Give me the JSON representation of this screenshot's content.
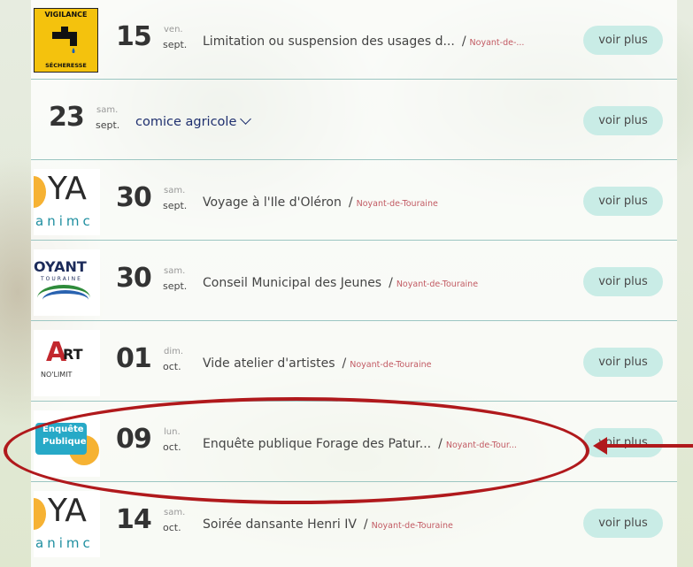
{
  "events": [
    {
      "day": "15",
      "dow": "ven.",
      "month": "sept.",
      "title": "Limitation ou suspension des usages d...",
      "location": "Noyant-de-...",
      "button": "voir plus",
      "thumb": "vigilance",
      "thumb_text": {
        "top": "VIGILANCE",
        "bottom": "SÉCHERESSE"
      }
    },
    {
      "day": "23",
      "dow": "sam.",
      "month": "sept.",
      "title": "comice agricole",
      "button": "voir plus"
    },
    {
      "day": "30",
      "dow": "sam.",
      "month": "sept.",
      "title": "Voyage à l'Ile d'Oléron",
      "location": "Noyant-de-Touraine",
      "button": "voir plus",
      "thumb": "ya",
      "thumb_text": {
        "main": "YA",
        "sub": "animc"
      }
    },
    {
      "day": "30",
      "dow": "sam.",
      "month": "sept.",
      "title": "Conseil Municipal des Jeunes",
      "location": "Noyant-de-Touraine",
      "button": "voir plus",
      "thumb": "noyant",
      "thumb_text": {
        "main": "OYANT",
        "sub": "TOURAINE"
      }
    },
    {
      "day": "01",
      "dow": "dim.",
      "month": "oct.",
      "title": "Vide atelier d'artistes",
      "location": "Noyant-de-Touraine",
      "button": "voir plus",
      "thumb": "art",
      "thumb_text": {
        "a": "A",
        "rt": "RT",
        "sub": "NO'LIMIT"
      }
    },
    {
      "day": "09",
      "dow": "lun.",
      "month": "oct.",
      "title": "Enquête publique Forage des Patur...",
      "location": "Noyant-de-Tour...",
      "button": "voir plus",
      "thumb": "enquete",
      "thumb_text": {
        "line1": "Enquête",
        "line2": "Publique"
      }
    },
    {
      "day": "14",
      "dow": "sam.",
      "month": "oct.",
      "title": "Soirée dansante Henri IV",
      "location": "Noyant-de-Touraine",
      "button": "voir plus",
      "thumb": "ya",
      "thumb_text": {
        "main": "YA",
        "sub": "animc"
      }
    }
  ],
  "separator": "/",
  "colors": {
    "button_bg": "#c9ece6",
    "location": "#c25a63",
    "annotation": "#b0191c",
    "divider": "#9cc6c2"
  }
}
